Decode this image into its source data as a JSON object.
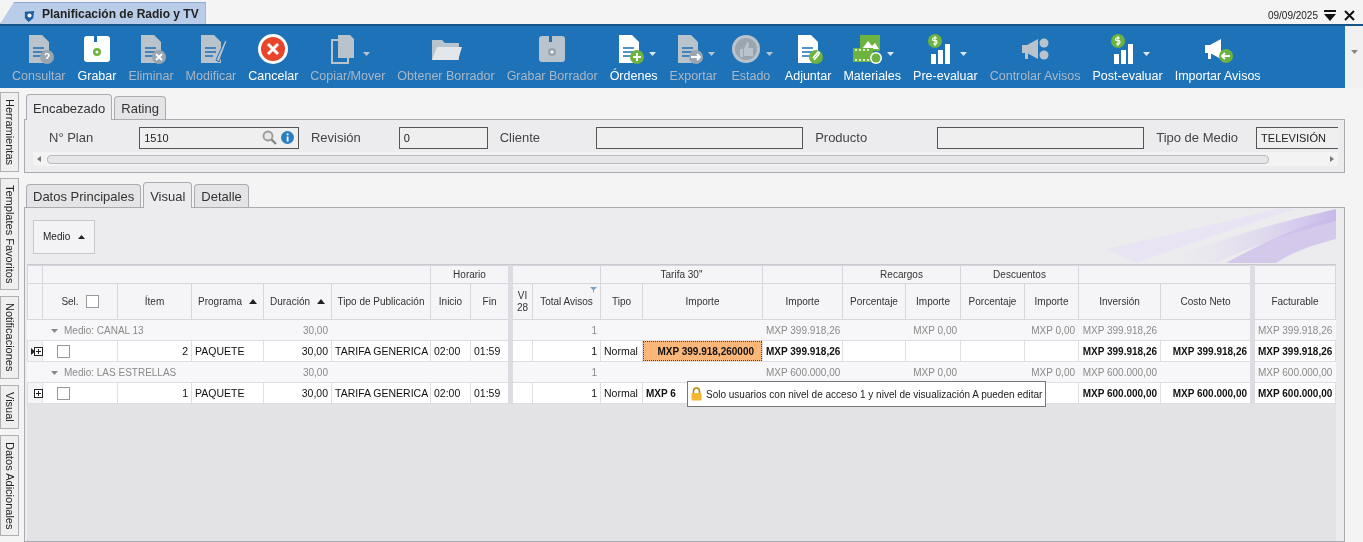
{
  "window": {
    "tab_title": "Planificación de Radio y TV",
    "date": "09/09/2025"
  },
  "toolbar": [
    {
      "label": "Consultar",
      "disabled": true,
      "has_menu": false
    },
    {
      "label": "Grabar",
      "disabled": false,
      "has_menu": false
    },
    {
      "label": "Eliminar",
      "disabled": true,
      "has_menu": false
    },
    {
      "label": "Modificar",
      "disabled": true,
      "has_menu": false
    },
    {
      "label": "Cancelar",
      "disabled": false,
      "has_menu": false
    },
    {
      "label": "Copiar/Mover",
      "disabled": true,
      "has_menu": true
    },
    {
      "label": "Obtener Borrador",
      "disabled": true,
      "has_menu": false
    },
    {
      "label": "Grabar Borrador",
      "disabled": true,
      "has_menu": false
    },
    {
      "label": "Órdenes",
      "disabled": false,
      "has_menu": true
    },
    {
      "label": "Exportar",
      "disabled": true,
      "has_menu": true
    },
    {
      "label": "Estado",
      "disabled": true,
      "has_menu": true
    },
    {
      "label": "Adjuntar",
      "disabled": false,
      "has_menu": false
    },
    {
      "label": "Materiales",
      "disabled": false,
      "has_menu": true
    },
    {
      "label": "Pre-evaluar",
      "disabled": false,
      "has_menu": true
    },
    {
      "label": "Controlar Avisos",
      "disabled": true,
      "has_menu": false
    },
    {
      "label": "Post-evaluar",
      "disabled": false,
      "has_menu": true
    },
    {
      "label": "Importar Avisos",
      "disabled": false,
      "has_menu": false
    }
  ],
  "side_tabs": [
    {
      "label": "Herramientas"
    },
    {
      "label": "Templates Favoritos"
    },
    {
      "label": "Notificaciones"
    },
    {
      "label": "Visual"
    },
    {
      "label": "Datos Adicionales"
    }
  ],
  "header_tabs": [
    {
      "label": "Encabezado",
      "selected": true
    },
    {
      "label": "Rating",
      "selected": false
    }
  ],
  "header_fields": [
    {
      "label": "N° Plan",
      "value": "1510",
      "kind": "lookup"
    },
    {
      "label": "Revisión",
      "value": "0",
      "kind": "text"
    },
    {
      "label": "Cliente",
      "kind": "text"
    },
    {
      "label": "Producto",
      "kind": "text"
    },
    {
      "label": "Tipo de Medio",
      "value": "TELEVISIÓN",
      "kind": "text"
    }
  ],
  "detail_tabs": [
    {
      "label": "Datos Principales",
      "selected": false
    },
    {
      "label": "Visual",
      "selected": true
    },
    {
      "label": "Detalle",
      "selected": false
    }
  ],
  "group_by": {
    "label": "Medio",
    "sorted": true
  },
  "grid": {
    "header_groups": [
      "Horario",
      "Tarifa 30\"",
      "Recargos",
      "Descuentos"
    ],
    "select_all_checked": false,
    "columns": [
      {
        "label": "Sel."
      },
      {
        "label": "Ítem"
      },
      {
        "label": "Programa",
        "sorted": true
      },
      {
        "label": "Duración",
        "sorted": true
      },
      {
        "label": "Tipo de Publicación"
      },
      {
        "label": "Inicio"
      },
      {
        "label": "Fin"
      },
      {
        "label": "VI 28"
      },
      {
        "label": "Total Avisos",
        "filter": true
      },
      {
        "label": "Tipo"
      },
      {
        "label": "Importe"
      },
      {
        "label": "Importe"
      },
      {
        "label": "Porcentaje"
      },
      {
        "label": "Importe"
      },
      {
        "label": "Porcentaje"
      },
      {
        "label": "Importe"
      },
      {
        "label": "Inversión"
      },
      {
        "label": "Costo Neto"
      },
      {
        "label": "Facturable"
      }
    ],
    "groups": [
      {
        "label": "Medio: CANAL 13",
        "expanded": true,
        "summary": {
          "duracion": "30,00",
          "total_avisos": "1",
          "importe": "MXP 399.918,26",
          "recargo_importe": "MXP 0,00",
          "descuento_importe": "MXP 0,00",
          "inversion": "MXP 399.918,26",
          "facturable": "MXP 399.918,26"
        },
        "rows": [
          {
            "current": true,
            "checked": false,
            "tarifa_cell_selected": true,
            "partly_covered": false,
            "cells": {
              "item": "2",
              "programa": "PAQUETE",
              "duracion": "30,00",
              "tipo_pub": "TARIFA GENERICA",
              "inicio": "02:00",
              "fin": "01:59",
              "total_avisos": "1",
              "tipo": "Normal",
              "tarifa_importe": "MXP 399.918,260000",
              "importe": "MXP 399.918,26",
              "inversion": "MXP 399.918,26",
              "costo_neto": "MXP 399.918,26",
              "facturable": "MXP 399.918,26"
            }
          }
        ]
      },
      {
        "label": "Medio: LAS ESTRELLAS",
        "expanded": true,
        "summary": {
          "duracion": "30,00",
          "total_avisos": "1",
          "importe": "MXP 600.000,00",
          "recargo_importe": "MXP 0,00",
          "descuento_importe": "MXP 0,00",
          "inversion": "MXP 600.000,00",
          "facturable": "MXP 600.000,00"
        },
        "rows": [
          {
            "current": false,
            "checked": false,
            "tarifa_cell_selected": false,
            "partly_covered": true,
            "cells": {
              "item": "1",
              "programa": "PAQUETE",
              "duracion": "30,00",
              "tipo_pub": "TARIFA GENERICA",
              "inicio": "02:00",
              "fin": "01:59",
              "total_avisos": "1",
              "tipo": "Normal",
              "tarifa_importe": "MXP 6",
              "inversion": "MXP 600.000,00",
              "costo_neto": "MXP 600.000,00",
              "facturable": "MXP 600.000,00"
            }
          }
        ]
      }
    ]
  },
  "tooltip": {
    "text": "Solo usuarios con nivel de acceso 1 y nivel de visualización A pueden editar"
  }
}
